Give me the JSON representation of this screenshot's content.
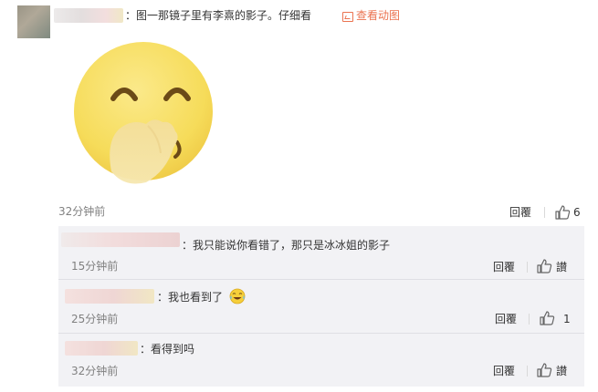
{
  "comment": {
    "text": "：图一那镜子里有李熹的影子。仔细看",
    "link_label": "查看动图",
    "time": "32分钟前",
    "reply_label": "回覆",
    "like_count": "6"
  },
  "replies": [
    {
      "text": "：我只能说你看错了，那只是冰冰姐的影子",
      "time": "15分钟前",
      "reply_label": "回覆",
      "like_count": "讃"
    },
    {
      "text": "：我也看到了",
      "time": "25分钟前",
      "reply_label": "回覆",
      "like_count": "1"
    },
    {
      "text": "：看得到吗",
      "time": "32分钟前",
      "reply_label": "回覆",
      "like_count": "讃"
    }
  ],
  "colors": {
    "link": "#eb7350",
    "reply_bg": "#f2f2f5",
    "emoji_yellow": "#f6dc5a"
  },
  "icons": [
    "gif-link-icon",
    "thumbs-up-icon",
    "laughing-crying-emoji",
    "shy-smile-emoji"
  ]
}
